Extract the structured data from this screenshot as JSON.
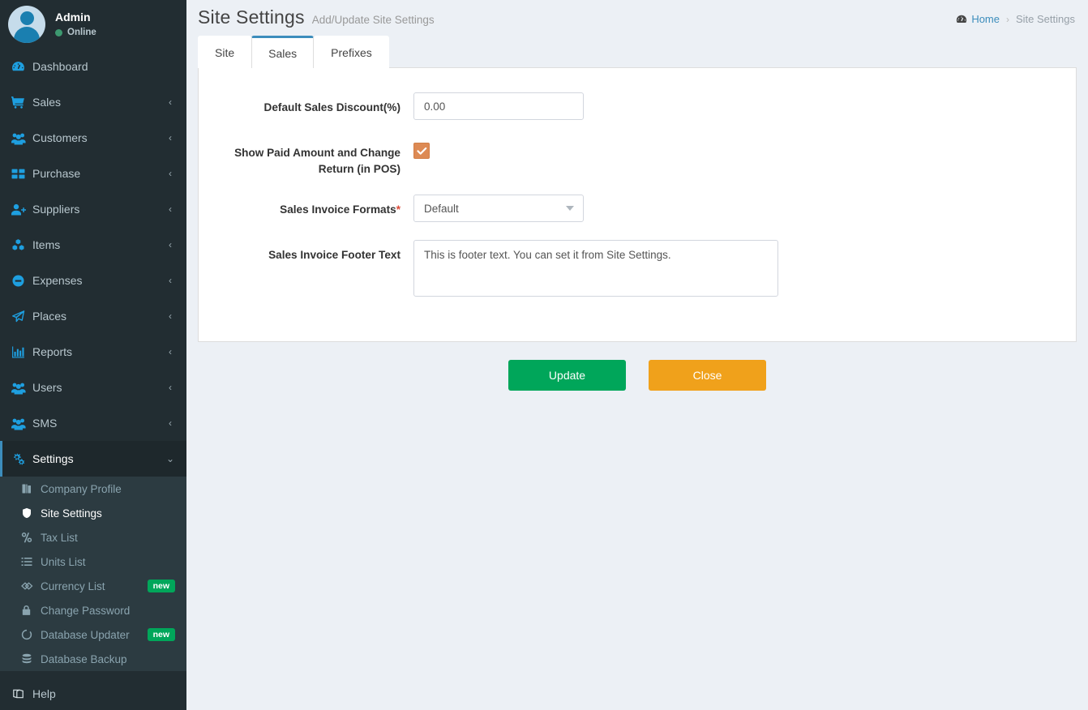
{
  "sidebar": {
    "user": {
      "name": "Admin",
      "status": "Online",
      "avatar_icon": "user-avatar-icon"
    },
    "items": [
      {
        "label": "Dashboard",
        "icon": "dashboard-icon",
        "arrow": ""
      },
      {
        "label": "Sales",
        "icon": "cart-icon",
        "arrow": "‹"
      },
      {
        "label": "Customers",
        "icon": "users-group-icon",
        "arrow": "‹"
      },
      {
        "label": "Purchase",
        "icon": "grid-icon",
        "arrow": "‹"
      },
      {
        "label": "Suppliers",
        "icon": "user-plus-icon",
        "arrow": "‹"
      },
      {
        "label": "Items",
        "icon": "cubes-icon",
        "arrow": "‹"
      },
      {
        "label": "Expenses",
        "icon": "minus-circle-icon",
        "arrow": "‹"
      },
      {
        "label": "Places",
        "icon": "paper-plane-icon",
        "arrow": "‹"
      },
      {
        "label": "Reports",
        "icon": "bar-chart-icon",
        "arrow": "‹"
      },
      {
        "label": "Users",
        "icon": "users-group-icon",
        "arrow": "‹"
      },
      {
        "label": "SMS",
        "icon": "users-group-icon",
        "arrow": "‹"
      },
      {
        "label": "Settings",
        "icon": "gears-icon",
        "arrow": "⌄"
      }
    ],
    "settings_submenu": [
      {
        "label": "Company Profile",
        "icon": "building-icon",
        "badge": ""
      },
      {
        "label": "Site Settings",
        "icon": "shield-icon",
        "badge": ""
      },
      {
        "label": "Tax List",
        "icon": "percent-icon",
        "badge": ""
      },
      {
        "label": "Units List",
        "icon": "list-icon",
        "badge": ""
      },
      {
        "label": "Currency List",
        "icon": "currency-icon",
        "badge": "new"
      },
      {
        "label": "Change Password",
        "icon": "lock-icon",
        "badge": ""
      },
      {
        "label": "Database Updater",
        "icon": "refresh-circle-icon",
        "badge": "new"
      },
      {
        "label": "Database Backup",
        "icon": "database-icon",
        "badge": ""
      }
    ],
    "help": {
      "label": "Help",
      "icon": "book-icon"
    }
  },
  "header": {
    "title": "Site Settings",
    "subtitle": "Add/Update Site Settings",
    "breadcrumb": {
      "home_label": "Home",
      "home_icon": "dashboard-icon",
      "separator": "›",
      "current": "Site Settings"
    }
  },
  "tabs": [
    {
      "label": "Site",
      "active": false
    },
    {
      "label": "Sales",
      "active": true
    },
    {
      "label": "Prefixes",
      "active": false
    }
  ],
  "form": {
    "discount": {
      "label": "Default Sales Discount(%)",
      "value": "0.00",
      "placeholder": ""
    },
    "show_paid": {
      "label": "Show Paid Amount and Change Return (in POS)",
      "checked": true,
      "check_icon": "check-icon"
    },
    "invoice_format": {
      "label": "Sales Invoice Formats",
      "required": "*",
      "value": "Default",
      "options": [
        "Default"
      ]
    },
    "footer_text": {
      "label": "Sales Invoice Footer Text",
      "value": "This is footer text. You can set it from Site Settings."
    }
  },
  "actions": {
    "update_label": "Update",
    "close_label": "Close"
  },
  "colors": {
    "sidebar_bg": "#222d32",
    "submenu_bg": "#2c3b41",
    "accent_blue": "#3c8dbc",
    "icon_blue": "#1e9fe0",
    "green": "#00a65a",
    "orange": "#f0a11b",
    "checkbox_orange": "#dd8a54",
    "page_bg": "#ecf0f5"
  }
}
